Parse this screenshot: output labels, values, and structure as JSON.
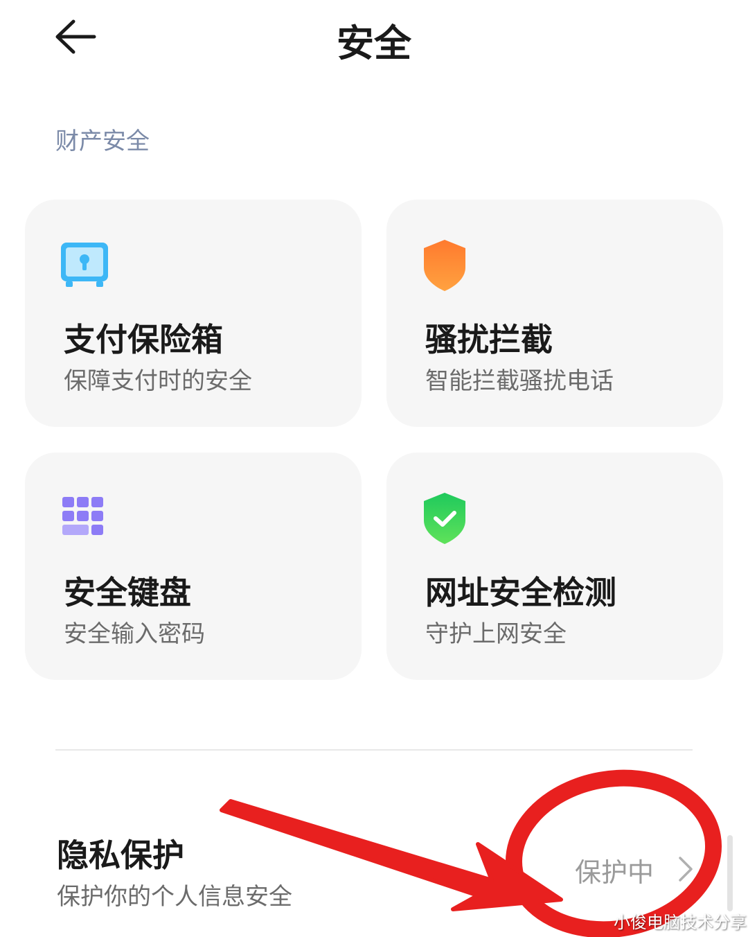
{
  "header": {
    "title": "安全",
    "back_icon": "arrow-left-icon"
  },
  "section": {
    "label": "财产安全"
  },
  "cards": [
    {
      "title": "支付保险箱",
      "subtitle": "保障支付时的安全",
      "icon": "safe-box-icon",
      "color": "#3db7f6"
    },
    {
      "title": "骚扰拦截",
      "subtitle": "智能拦截骚扰电话",
      "icon": "orange-shield-icon",
      "color": "#ff8a2a"
    },
    {
      "title": "安全键盘",
      "subtitle": "安全输入密码",
      "icon": "keyboard-icon",
      "color": "#8d7cf6"
    },
    {
      "title": "网址安全检测",
      "subtitle": "守护上网安全",
      "icon": "green-shield-check-icon",
      "color": "#2ed15a"
    }
  ],
  "privacy": {
    "title": "隐私保护",
    "subtitle": "保护你的个人信息安全",
    "status": "保护中",
    "chevron_icon": "chevron-right-icon"
  },
  "annotation": {
    "color": "#e8201f",
    "shapes": [
      "red-circle",
      "red-arrow"
    ]
  },
  "watermark": {
    "text": "小俊电脑技术分享"
  }
}
